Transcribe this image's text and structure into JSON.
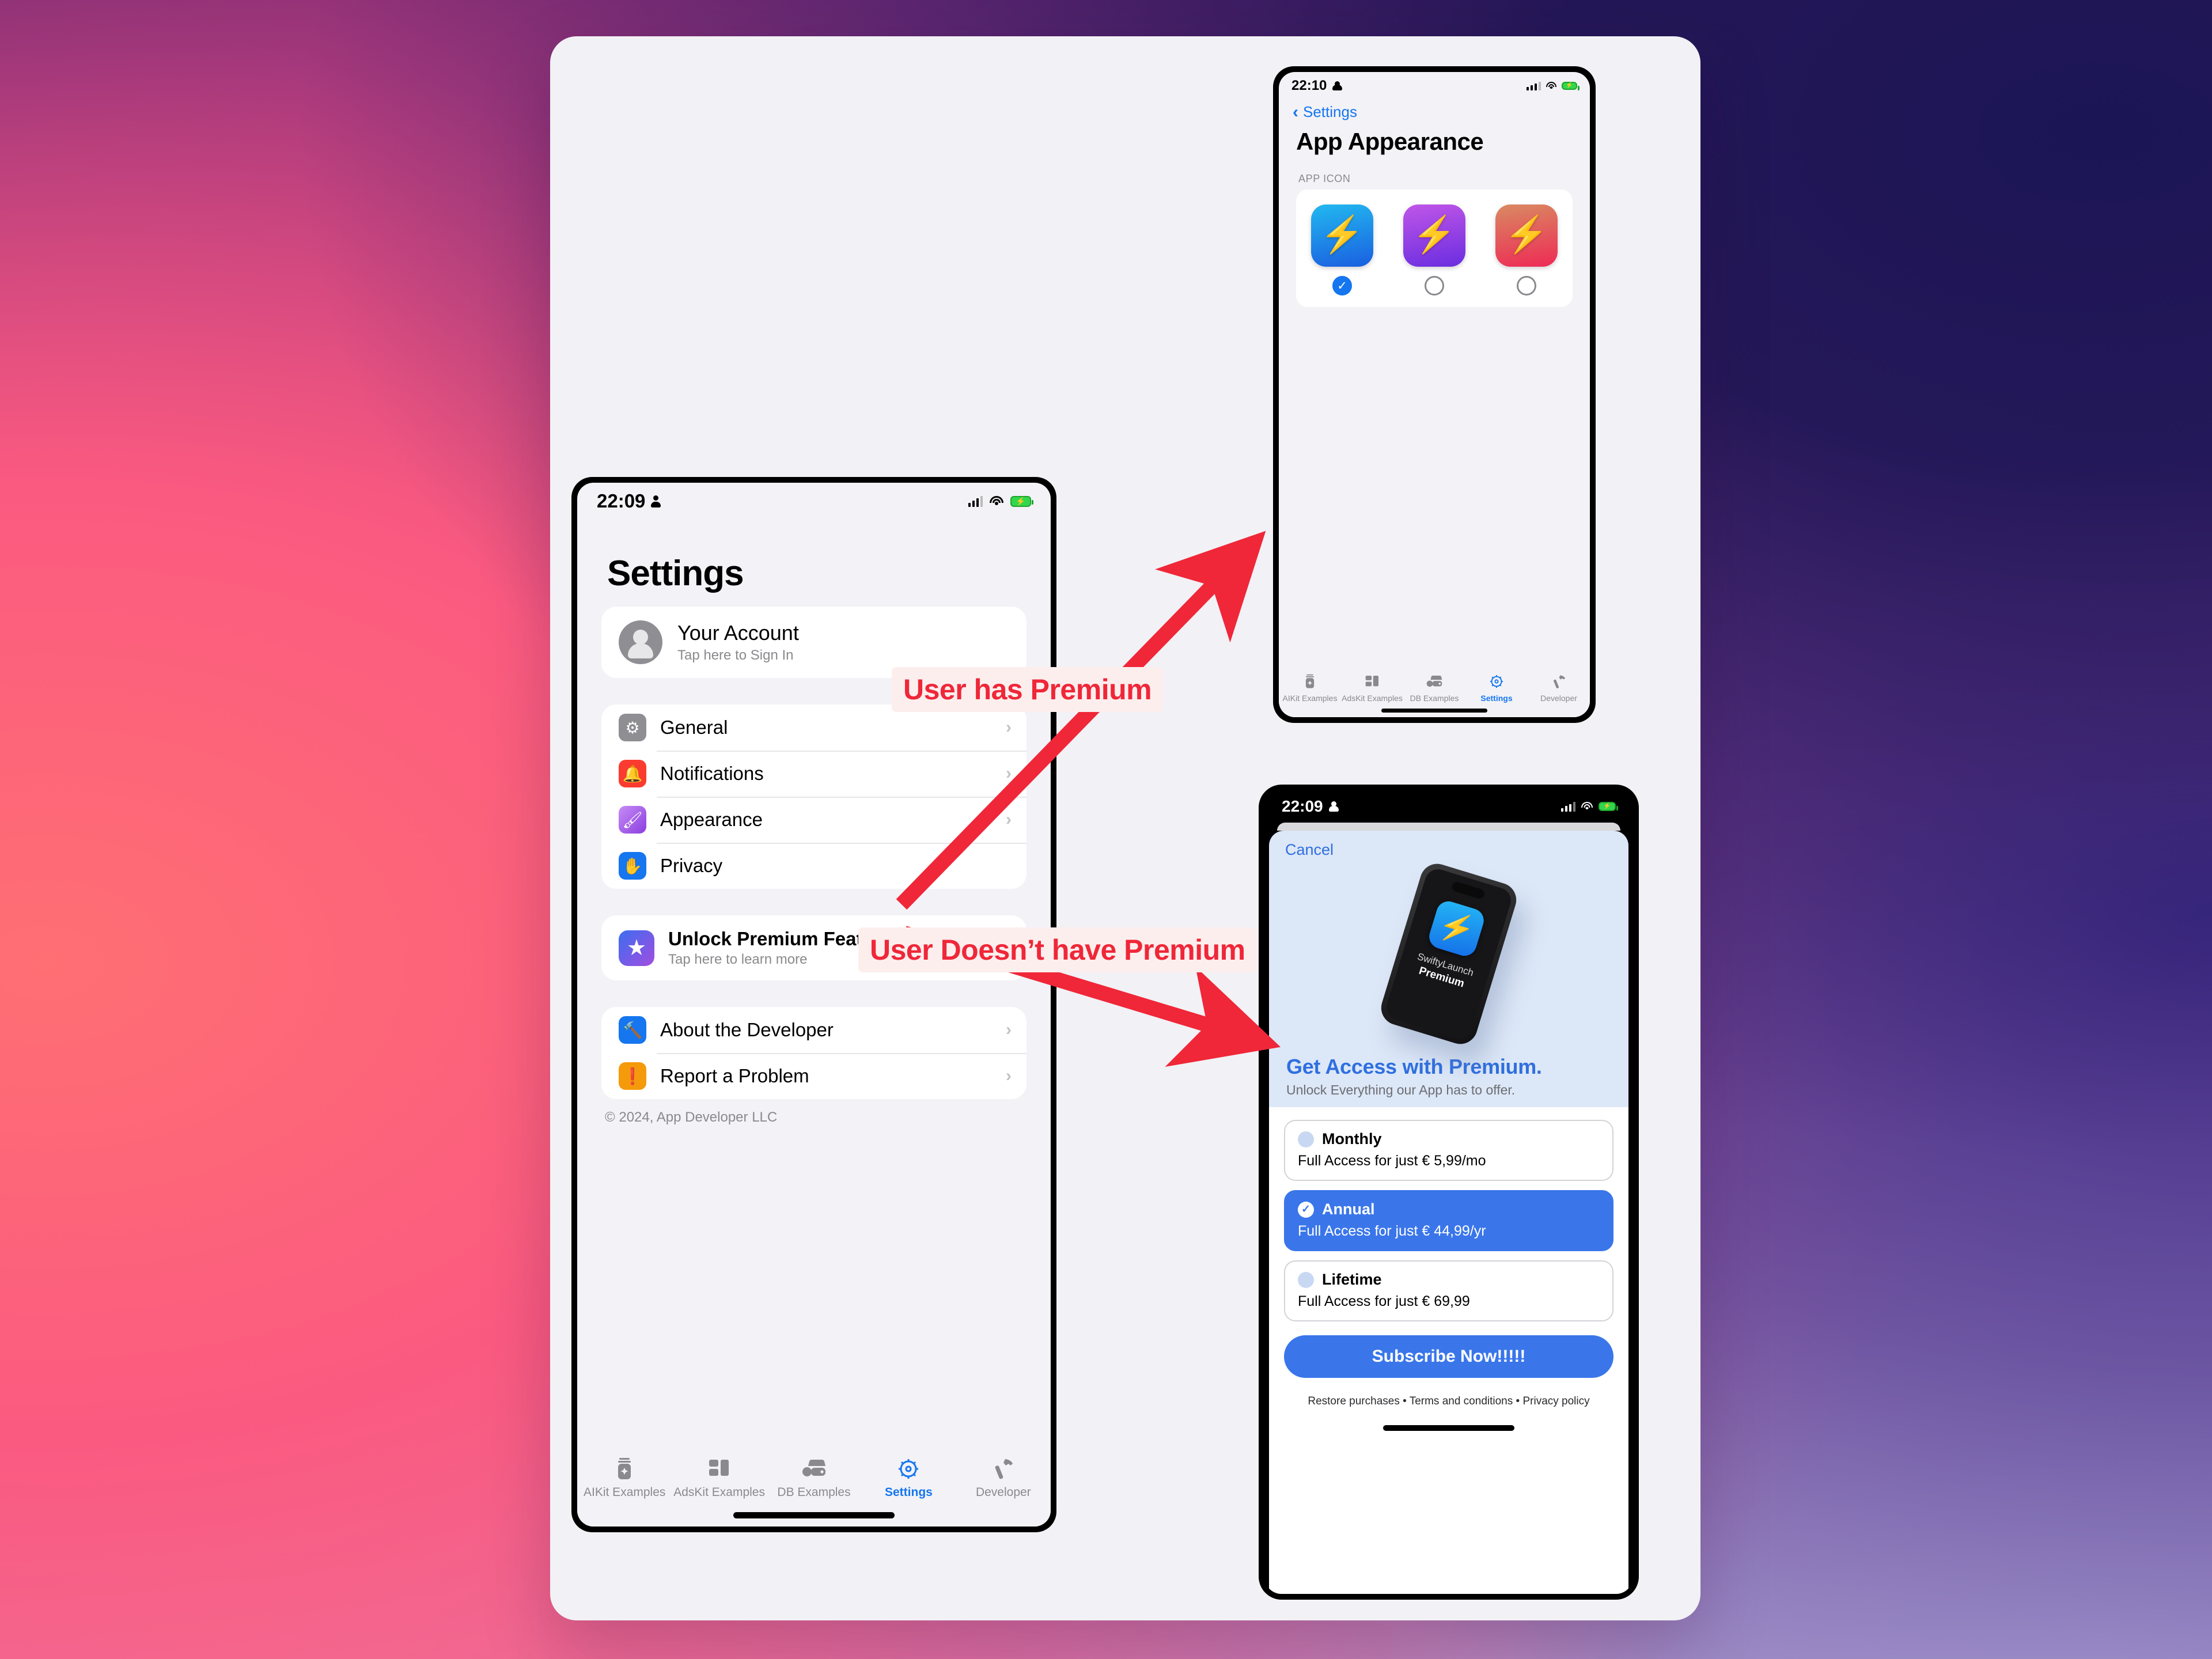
{
  "annotations": {
    "has_premium": "User has Premium",
    "no_premium": "User Doesn’t have Premium",
    "accent_red": "#EF2738",
    "badge_bg": "#FDEEEE"
  },
  "settings_phone": {
    "status": {
      "time": "22:09",
      "person_icon": "person-icon",
      "signal_icon": "cellular-bars-icon",
      "wifi_icon": "wifi-icon",
      "battery_icon": "battery-charging-icon"
    },
    "title": "Settings",
    "account": {
      "name": "Your Account",
      "subtitle": "Tap here to Sign In",
      "avatar_icon": "person-avatar-icon"
    },
    "menu": [
      {
        "label": "General",
        "icon": "gear-icon",
        "color": "#8e8e93",
        "chevron": "›"
      },
      {
        "label": "Notifications",
        "icon": "bell-icon",
        "color": "#fa3b30",
        "chevron": "›"
      },
      {
        "label": "Appearance",
        "icon": "paintbrush-icon",
        "color": "#a855f7",
        "chevron": "›"
      },
      {
        "label": "Privacy",
        "icon": "hand-raised-icon",
        "color": "#1576f0",
        "chevron": "›"
      }
    ],
    "premium": {
      "title": "Unlock Premium Features",
      "subtitle": "Tap here to learn more",
      "icon": "star-icon",
      "chevron": "›"
    },
    "developer_rows": [
      {
        "label": "About the Developer",
        "icon": "hammer-icon",
        "color": "#1576f0",
        "chevron": "›"
      },
      {
        "label": "Report a Problem",
        "icon": "exclamation-bubble-icon",
        "color": "#f59a0b",
        "chevron": "›"
      }
    ],
    "copyright": "© 2024, App Developer LLC",
    "tabs": [
      {
        "label": "AIKit Examples",
        "icon": "ai-jar-icon",
        "active": false
      },
      {
        "label": "AdsKit Examples",
        "icon": "ads-blocks-icon",
        "active": false
      },
      {
        "label": "DB Examples",
        "icon": "database-icon",
        "active": false
      },
      {
        "label": "Settings",
        "icon": "gear-icon",
        "active": true
      },
      {
        "label": "Developer",
        "icon": "hammer-icon",
        "active": false
      }
    ],
    "active_tab_color": "#1576F0"
  },
  "appearance_phone": {
    "status": {
      "time": "22:10",
      "person_icon": "person-icon",
      "signal_icon": "cellular-bars-icon",
      "wifi_icon": "wifi-icon",
      "battery_icon": "battery-charging-icon"
    },
    "back_label": "Settings",
    "back_icon": "chevron-left-icon",
    "title": "App Appearance",
    "section_label": "APP ICON",
    "icons": [
      {
        "name": "Blue icon",
        "glyph": "zap-icon",
        "gradient_from": "#22b8f0",
        "gradient_to": "#1a5fe0",
        "selected": true
      },
      {
        "name": "Purple icon",
        "glyph": "zap-icon",
        "gradient_from": "#c056e8",
        "gradient_to": "#6a2de0",
        "selected": false
      },
      {
        "name": "Red icon",
        "glyph": "zap-icon",
        "gradient_from": "#d98a62",
        "gradient_to": "#ee2a55",
        "selected": false
      }
    ],
    "check_glyph": "✓",
    "tabs": [
      {
        "label": "AIKit Examples",
        "icon": "ai-jar-icon",
        "active": false
      },
      {
        "label": "AdsKit Examples",
        "icon": "ads-blocks-icon",
        "active": false
      },
      {
        "label": "DB Examples",
        "icon": "database-icon",
        "active": false
      },
      {
        "label": "Settings",
        "icon": "gear-icon",
        "active": true
      },
      {
        "label": "Developer",
        "icon": "hammer-icon",
        "active": false
      }
    ]
  },
  "paywall_phone": {
    "status": {
      "time": "22:09",
      "person_icon": "person-icon",
      "signal_icon": "cellular-bars-icon",
      "wifi_icon": "wifi-icon",
      "battery_icon": "battery-charging-icon"
    },
    "cancel_label": "Cancel",
    "hero": {
      "app_name": "SwiftyLaunch",
      "tier": "Premium",
      "icon": "zap-icon"
    },
    "headline": "Get Access with Premium.",
    "subheadline": "Unlock Everything our App has to offer.",
    "plans": [
      {
        "name": "Monthly",
        "detail": "Full Access for just € 5,99/mo",
        "selected": false
      },
      {
        "name": "Annual",
        "detail": "Full Access for just € 44,99/yr",
        "selected": true
      },
      {
        "name": "Lifetime",
        "detail": "Full Access for just € 69,99",
        "selected": false
      }
    ],
    "subscribe_label": "Subscribe Now!!!!!",
    "legal_links": [
      "Restore purchases",
      "Terms and conditions",
      "Privacy policy"
    ],
    "legal_separator": " • ",
    "accent_blue": "#3A76EA"
  }
}
